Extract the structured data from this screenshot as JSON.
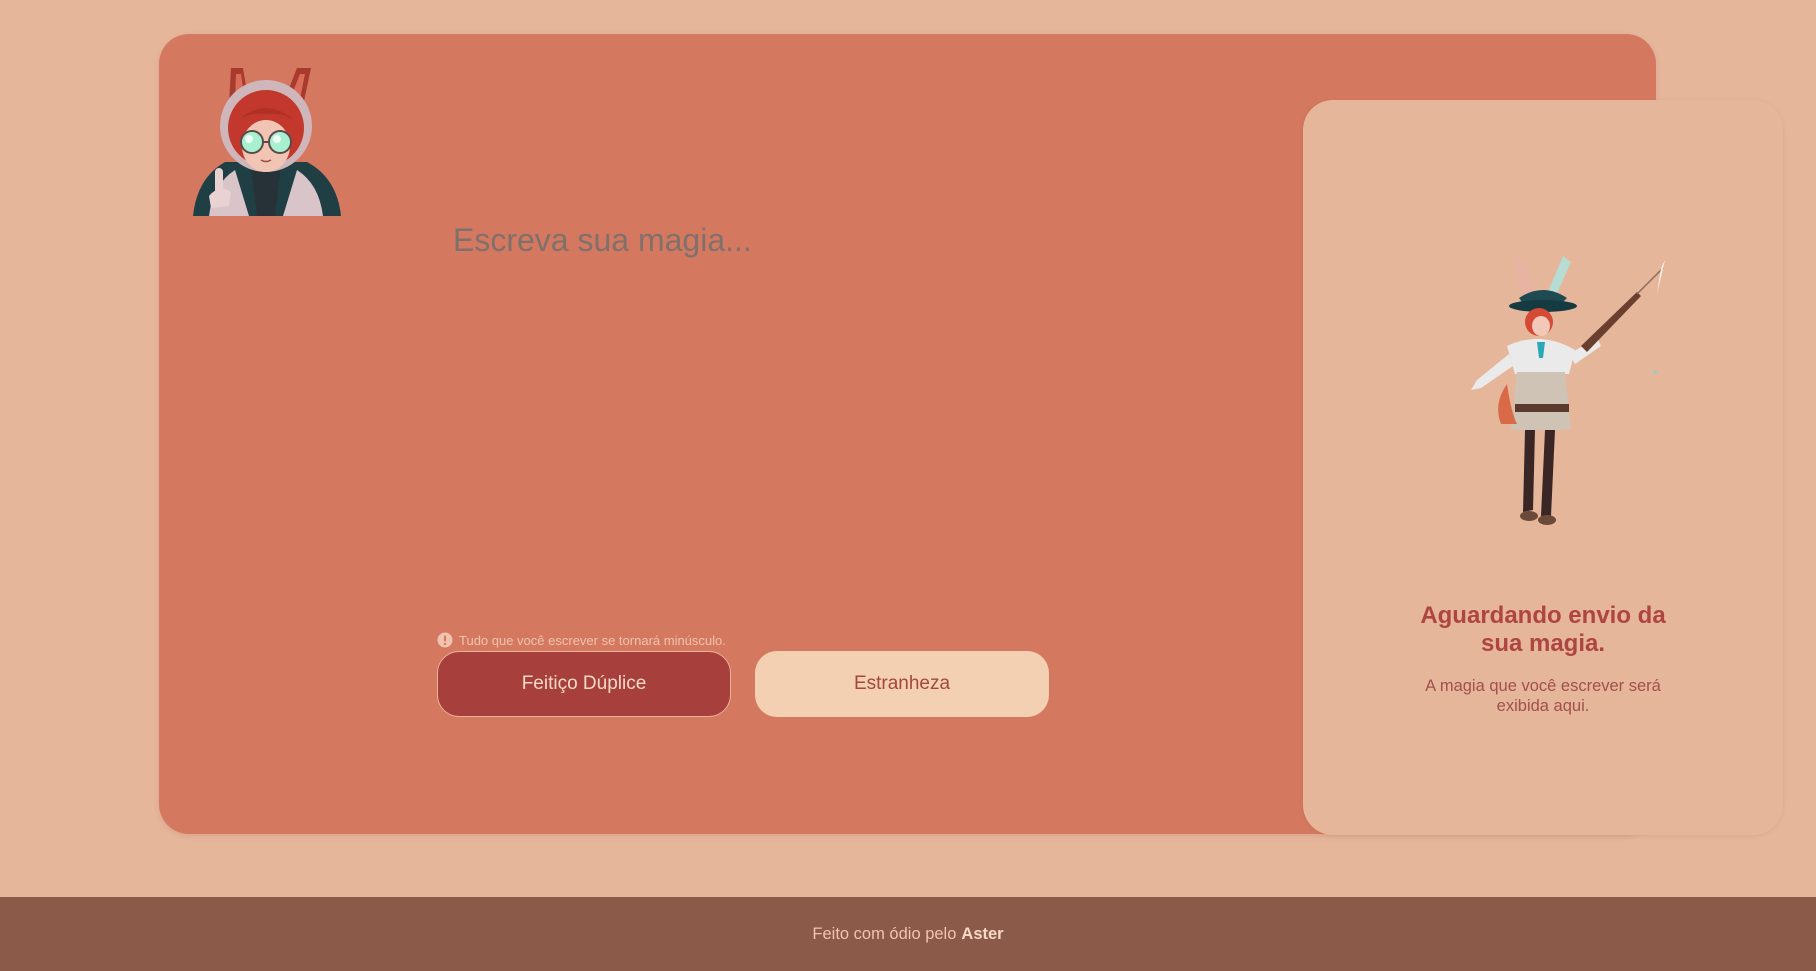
{
  "editor": {
    "placeholder": "Escreva sua magia...",
    "hint": "Tudo que você escrever se tornará minúsculo."
  },
  "buttons": {
    "primary_label": "Feitiço Dúplice",
    "secondary_label": "Estranheza"
  },
  "result": {
    "title": "Aguardando envio da sua magia.",
    "subtitle": "A magia que você escrever será exibida aqui."
  },
  "footer": {
    "prefix": "Feito com ódio pelo",
    "author": "Aster"
  },
  "colors": {
    "page_bg": "#e6b69b",
    "card_bg": "#d57860",
    "primary_button": "#a7403c",
    "secondary_button": "#f3d0b1",
    "footer_bg": "#8b5a48",
    "title_text": "#ae4541"
  },
  "icons": {
    "hint": "info-icon",
    "avatar": "bunny-eared-girl-avatar",
    "illustration": "bunny-mage-illustration"
  }
}
